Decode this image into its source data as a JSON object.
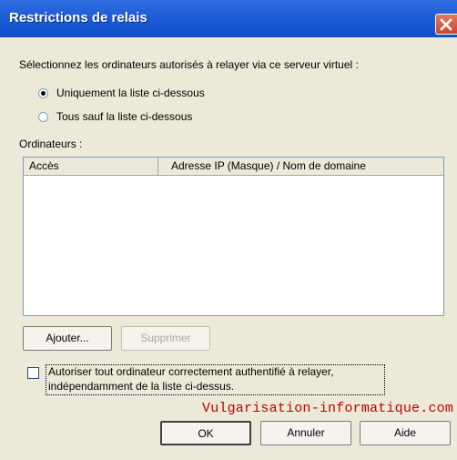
{
  "window": {
    "title": "Restrictions de relais"
  },
  "instructions": "Sélectionnez les ordinateurs autorisés à relayer via ce serveur virtuel :",
  "radio_options": [
    {
      "label": "Uniquement la liste ci-dessous",
      "checked": true
    },
    {
      "label": "Tous sauf la liste ci-dessous",
      "checked": false
    }
  ],
  "computers": {
    "label": "Ordinateurs :",
    "columns": [
      "Accès",
      "Adresse IP (Masque) / Nom de domaine"
    ],
    "rows": []
  },
  "buttons": {
    "add": "Ajouter...",
    "remove": "Supprimer",
    "ok": "OK",
    "cancel": "Annuler",
    "help": "Aide"
  },
  "checkbox": {
    "line1": "Autoriser tout ordinateur correctement authentifié à relayer,",
    "line2": "indépendamment de la liste ci-dessus.",
    "checked": false
  },
  "watermark": "Vulgarisation-informatique.com"
}
